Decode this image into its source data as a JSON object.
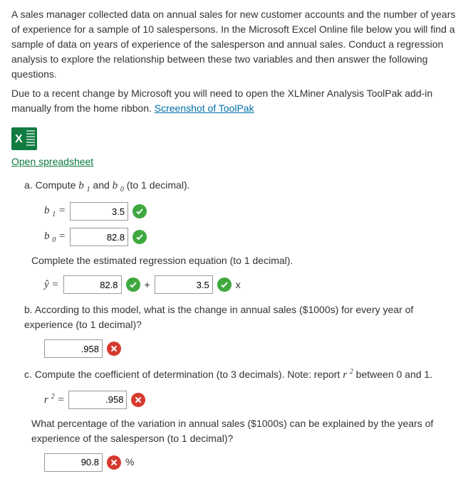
{
  "para1": "A sales manager collected data on annual sales for new customer accounts and the number of years of experience for a sample of 10 salespersons. In the Microsoft Excel Online file below you will find a sample of data on years of experience of the salesperson and annual sales. Conduct a regression analysis to explore the relationship between these two variables and then answer the following questions.",
  "para2_a": "Due to a recent change by Microsoft you will need to open the XLMiner Analysis ToolPak add-in manually from the home ribbon. ",
  "para2_link": "Screenshot of ToolPak",
  "open_link": "Open spreadsheet",
  "a": {
    "prompt_a": "a. Compute ",
    "prompt_b": " and ",
    "prompt_c": " (to 1 decimal).",
    "b1": "3.5",
    "b0": "82.8",
    "eq_prompt": "Complete the estimated regression equation (to 1 decimal).",
    "eq_b0": "82.8",
    "eq_b1": "3.5"
  },
  "b": {
    "prompt": "b. According to this model, what is the change in annual sales ($1000s) for every year of experience (to 1 decimal)?",
    "val": ".958"
  },
  "c": {
    "prompt_a": "c. Compute the coefficient of determination (to 3 decimals). Note: report ",
    "prompt_b": " between 0 and 1.",
    "val": ".958",
    "q2": "What percentage of the variation in annual sales ($1000s) can be explained by the years of experience of the salesperson (to 1 decimal)?",
    "val2": "90.8",
    "pct": "%"
  }
}
